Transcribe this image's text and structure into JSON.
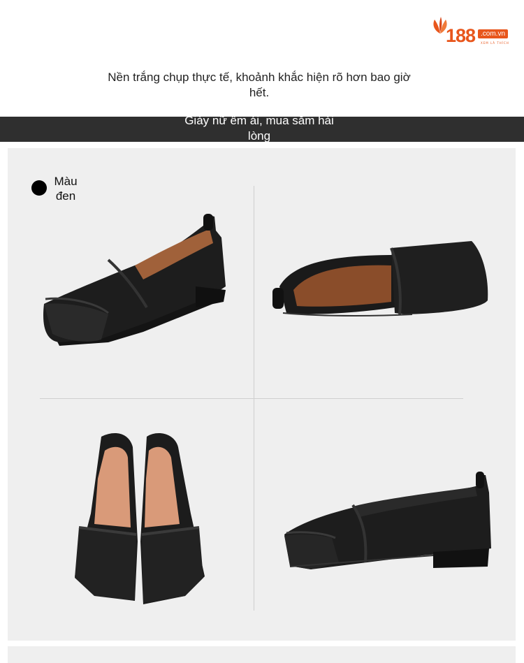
{
  "logo": {
    "number": "188",
    "domain": ".com.vn",
    "tagline": "XEM LÀ THÍCH",
    "brand_color": "#e8561c"
  },
  "intro": {
    "text": "Nền trắng chụp thực tế, khoảnh khắc hiện rõ hơn bao giờ hết."
  },
  "banner": {
    "text": "Giày nữ êm ái, mua sắm hài lòng",
    "background": "#2f2f2f"
  },
  "product": {
    "color_swatch": {
      "label": "Màu đen",
      "color": "#000000"
    },
    "views": [
      "shoe-side-view",
      "shoe-angled-top-view",
      "shoe-pair-front-view",
      "shoe-profile-view"
    ]
  }
}
